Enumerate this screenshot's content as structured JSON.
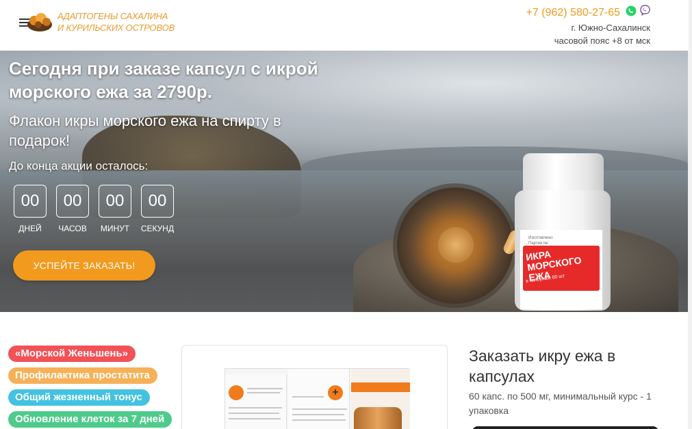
{
  "header": {
    "logo_line1": "АДАПТОГЕНЫ САХАЛИНА",
    "logo_line2": "И КУРИЛЬСКИХ ОСТРОВОВ",
    "phone": "+7 (962) 580-27-65",
    "city": "г. Южно-Сахалинск",
    "timezone": "часовой пояс +8 от мск"
  },
  "hero": {
    "title": "Сегодня при заказе капсул с икрой морского ежа за 2790р.",
    "subtitle": "Флакон икры морского ежа на спирту в подарок!",
    "timer_caption": "До конца акции осталось:",
    "timer": [
      {
        "value": "00",
        "label": "ДНЕЙ"
      },
      {
        "value": "00",
        "label": "ЧАСОВ"
      },
      {
        "value": "00",
        "label": "МИНУТ"
      },
      {
        "value": "00",
        "label": "СЕКУНД"
      }
    ],
    "cta": "УСПЕЙТЕ ЗАКАЗАТЬ!",
    "jar_title": "ИКРА МОРСКОГО ЕЖА",
    "jar_sub": "в капсулах, 60 шт",
    "jar_top_line1": "Изготовлено:",
    "jar_top_line2": "Партия №:"
  },
  "tags": [
    {
      "label": "«Морской Женьшень»",
      "color": "#f25256"
    },
    {
      "label": "Профилактика простатита",
      "color": "#f6b158"
    },
    {
      "label": "Общий жезненный тонус",
      "color": "#43c2e1"
    },
    {
      "label": "Обновление клеток за 7 дней",
      "color": "#4ecb8b"
    }
  ],
  "order": {
    "title": "Заказать икру ежа в капсулах",
    "description": "60 капс. по 500 мг, минимальный курс - 1 упаковка"
  },
  "colors": {
    "accent": "#f29a1d",
    "logo": "#e89b2e",
    "whatsapp": "#25d366",
    "viber": "#7b519d"
  }
}
